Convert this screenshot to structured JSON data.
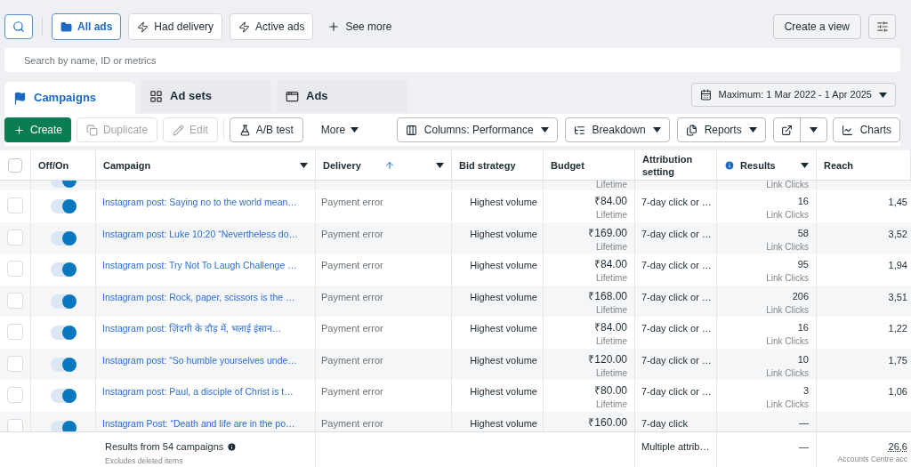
{
  "filters": {
    "chips": [
      {
        "label": "All ads",
        "selected": true
      },
      {
        "label": "Had delivery",
        "selected": false
      },
      {
        "label": "Active ads",
        "selected": false
      }
    ],
    "see_more": "See more",
    "create_view": "Create a view"
  },
  "search": {
    "placeholder": "Search by name, ID or metrics"
  },
  "tabs": [
    {
      "label": "Campaigns",
      "selected": true
    },
    {
      "label": "Ad sets",
      "selected": false
    },
    {
      "label": "Ads",
      "selected": false
    }
  ],
  "date_range": "Maximum: 1 Mar 2022 - 1 Apr 2025",
  "actions": [
    {
      "label": "Create",
      "kind": "primary",
      "disabled": false
    },
    {
      "label": "Duplicate",
      "kind": "plain",
      "disabled": true
    },
    {
      "label": "Edit",
      "kind": "plain",
      "disabled": true
    },
    {
      "label": "A/B test",
      "kind": "plain",
      "disabled": false
    },
    {
      "label": "More",
      "kind": "menu",
      "disabled": false
    }
  ],
  "view_buttons": [
    {
      "label": "Columns: Performance",
      "dropdown": true
    },
    {
      "label": "Breakdown",
      "dropdown": true
    },
    {
      "label": "Reports",
      "dropdown": true
    }
  ],
  "charts_button": "Charts",
  "table": {
    "select_all": {
      "checked": false
    },
    "columns": [
      {
        "label": "Off/On",
        "dropdown": false,
        "sorted": false,
        "info": false
      },
      {
        "label": "Campaign",
        "dropdown": true,
        "sorted": false,
        "info": false
      },
      {
        "label": "Delivery",
        "dropdown": true,
        "sorted": true,
        "info": false
      },
      {
        "label": "Bid strategy",
        "dropdown": false,
        "sorted": false,
        "info": false
      },
      {
        "label": "Budget",
        "dropdown": false,
        "sorted": false,
        "info": false
      },
      {
        "label": "Attribution setting",
        "dropdown": false,
        "sorted": false,
        "info": false
      },
      {
        "label": "Results",
        "dropdown": true,
        "sorted": false,
        "info": true
      },
      {
        "label": "Reach",
        "dropdown": false,
        "sorted": false,
        "info": false
      }
    ],
    "partial_row": {
      "budget_note": "Lifetime",
      "results_note": "Link Clicks",
      "on": true
    },
    "rows": [
      {
        "checked": false,
        "on": true,
        "campaign": "Instagram post: Saying no to the world mean…",
        "delivery": "Payment error",
        "bid_strategy": "Highest volume",
        "budget": "₹84.00",
        "budget_note": "Lifetime",
        "attribution": "7-day click or …",
        "results": "16",
        "results_note": "Link Clicks",
        "reach": "1,45"
      },
      {
        "checked": false,
        "on": true,
        "campaign": "Instagram post: Luke 10:20 “Nevertheless do…",
        "delivery": "Payment error",
        "bid_strategy": "Highest volume",
        "budget": "₹169.00",
        "budget_note": "Lifetime",
        "attribution": "7-day click or …",
        "results": "58",
        "results_note": "Link Clicks",
        "reach": "3,52"
      },
      {
        "checked": false,
        "on": true,
        "campaign": "Instagram post: Try Not To Laugh Challenge …",
        "delivery": "Payment error",
        "bid_strategy": "Highest volume",
        "budget": "₹84.00",
        "budget_note": "Lifetime",
        "attribution": "7-day click or …",
        "results": "95",
        "results_note": "Link Clicks",
        "reach": "1,94"
      },
      {
        "checked": false,
        "on": true,
        "campaign": "Instagram post: Rock, paper, scissors is the …",
        "delivery": "Payment error",
        "bid_strategy": "Highest volume",
        "budget": "₹168.00",
        "budget_note": "Lifetime",
        "attribution": "7-day click or …",
        "results": "206",
        "results_note": "Link Clicks",
        "reach": "3,51"
      },
      {
        "checked": false,
        "on": true,
        "campaign": "Instagram post: ज़िंदगी के दौड़ में, भलाई इंसान…",
        "delivery": "Payment error",
        "bid_strategy": "Highest volume",
        "budget": "₹84.00",
        "budget_note": "Lifetime",
        "attribution": "7-day click or …",
        "results": "16",
        "results_note": "Link Clicks",
        "reach": "1,22"
      },
      {
        "checked": false,
        "on": true,
        "campaign": "Instagram post: “So humble yourselves unde…",
        "delivery": "Payment error",
        "bid_strategy": "Highest volume",
        "budget": "₹120.00",
        "budget_note": "Lifetime",
        "attribution": "7-day click or …",
        "results": "10",
        "results_note": "Link Clicks",
        "reach": "1,75"
      },
      {
        "checked": false,
        "on": true,
        "campaign": "Instagram post: Paul, a disciple of Christ is t…",
        "delivery": "Payment error",
        "bid_strategy": "Highest volume",
        "budget": "₹80.00",
        "budget_note": "Lifetime",
        "attribution": "7-day click or …",
        "results": "3",
        "results_note": "Link Clicks",
        "reach": "1,06"
      },
      {
        "checked": false,
        "on": true,
        "campaign": "Instagram Post: “Death and life are in the po…",
        "delivery": "Payment error",
        "bid_strategy": "Highest volume",
        "budget": "₹160.00",
        "attribution": "7-day click",
        "results": "—"
      }
    ],
    "footer": {
      "summary": "Results from 54 campaigns",
      "note": "Excludes deleted items",
      "attribution": "Multiple attrib…",
      "results": "—",
      "reach": "26,6",
      "reach_note": "Accounts Centre acc"
    }
  }
}
